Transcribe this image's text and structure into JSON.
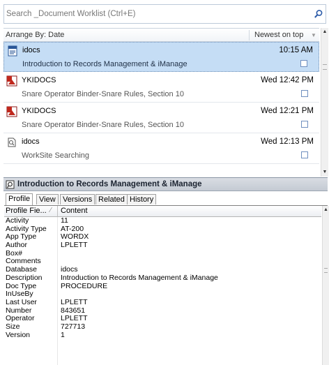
{
  "search": {
    "placeholder": "Search _Document Worklist (Ctrl+E)"
  },
  "arrange": {
    "label": "Arrange By: Date",
    "sort_label": "Newest on top"
  },
  "worklist": {
    "items": [
      {
        "author": "idocs",
        "time": "10:15 AM",
        "title": "Introduction to Records Management & iManage",
        "icon": "word-document-icon",
        "selected": true
      },
      {
        "author": "YKIDOCS",
        "time": "Wed 12:42 PM",
        "title": "Snare Operator Binder-Snare Rules, Section 10",
        "icon": "pdf-document-icon",
        "selected": false
      },
      {
        "author": "YKIDOCS",
        "time": "Wed 12:21 PM",
        "title": "Snare Operator Binder-Snare Rules, Section 10",
        "icon": "pdf-document-icon",
        "selected": false
      },
      {
        "author": "idocs",
        "time": "Wed 12:13 PM",
        "title": "WorkSite Searching",
        "icon": "search-document-icon",
        "selected": false
      }
    ]
  },
  "preview": {
    "title": "Introduction to Records Management & iManage"
  },
  "tabs": [
    "Profile",
    "View",
    "Versions",
    "Related",
    "History"
  ],
  "grid": {
    "header_field": "Profile Fie...",
    "header_content": "Content",
    "rows": [
      {
        "field": "Activity",
        "value": "11"
      },
      {
        "field": "Activity Type",
        "value": "AT-200"
      },
      {
        "field": "App Type",
        "value": "WORDX"
      },
      {
        "field": "Author",
        "value": "LPLETT"
      },
      {
        "field": "Box#",
        "value": ""
      },
      {
        "field": "Comments",
        "value": ""
      },
      {
        "field": "Database",
        "value": "idocs"
      },
      {
        "field": "Description",
        "value": "Introduction to Records Management & iManage"
      },
      {
        "field": "Doc Type",
        "value": "PROCEDURE"
      },
      {
        "field": "InUseBy",
        "value": ""
      },
      {
        "field": "Last User",
        "value": "LPLETT"
      },
      {
        "field": "Number",
        "value": "843651"
      },
      {
        "field": "Operator",
        "value": "LPLETT"
      },
      {
        "field": "Size",
        "value": "727713"
      },
      {
        "field": "Version",
        "value": "1"
      }
    ]
  },
  "colors": {
    "selected_row": "#c5ddf5",
    "accent": "#6d8fb5"
  }
}
